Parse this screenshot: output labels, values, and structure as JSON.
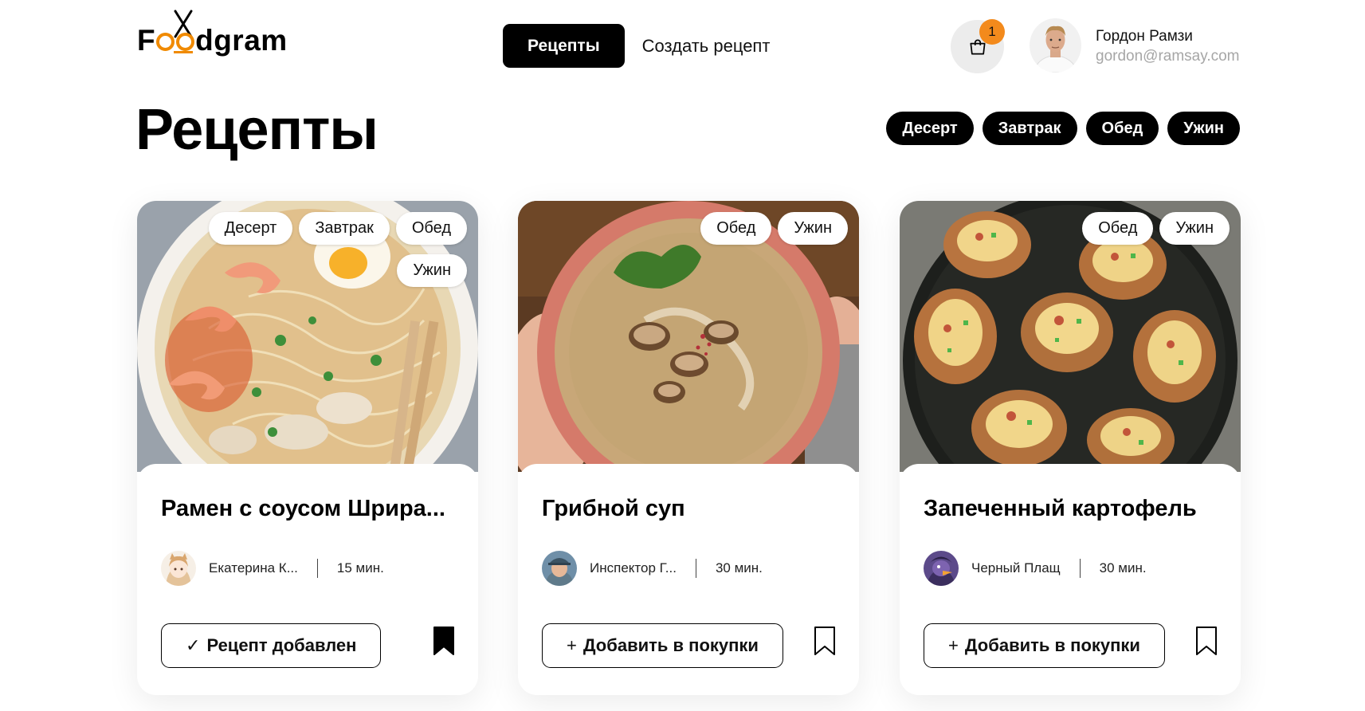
{
  "brand": {
    "logo_text_start": "F",
    "logo_text_end": "dgram",
    "logo_text": "Foodgram",
    "accent_color": "#f38a1c"
  },
  "nav": {
    "active_label": "Рецепты",
    "create_label": "Создать рецепт"
  },
  "cart": {
    "icon": "shopping-bag-icon",
    "count": "1"
  },
  "user": {
    "name": "Гордон Рамзи",
    "email": "gordon@ramsay.com"
  },
  "page": {
    "title": "Рецепты"
  },
  "filters": [
    "Десерт",
    "Завтрак",
    "Обед",
    "Ужин"
  ],
  "recipes": [
    {
      "title": "Рамен с соусом Шрира...",
      "tags": [
        "Десерт",
        "Завтрак",
        "Обед",
        "Ужин"
      ],
      "author": "Екатерина К...",
      "time": "15 мин.",
      "action_icon": "✓",
      "action_label": "Рецепт добавлен",
      "bookmarked": true
    },
    {
      "title": "Грибной суп",
      "tags": [
        "Обед",
        "Ужин"
      ],
      "author": "Инспектор Г...",
      "time": "30 мин.",
      "action_icon": "+",
      "action_label": "Добавить в покупки",
      "bookmarked": false
    },
    {
      "title": "Запеченный картофель",
      "tags": [
        "Обед",
        "Ужин"
      ],
      "author": "Черный Плащ",
      "time": "30 мин.",
      "action_icon": "+",
      "action_label": "Добавить в покупки",
      "bookmarked": false
    }
  ]
}
